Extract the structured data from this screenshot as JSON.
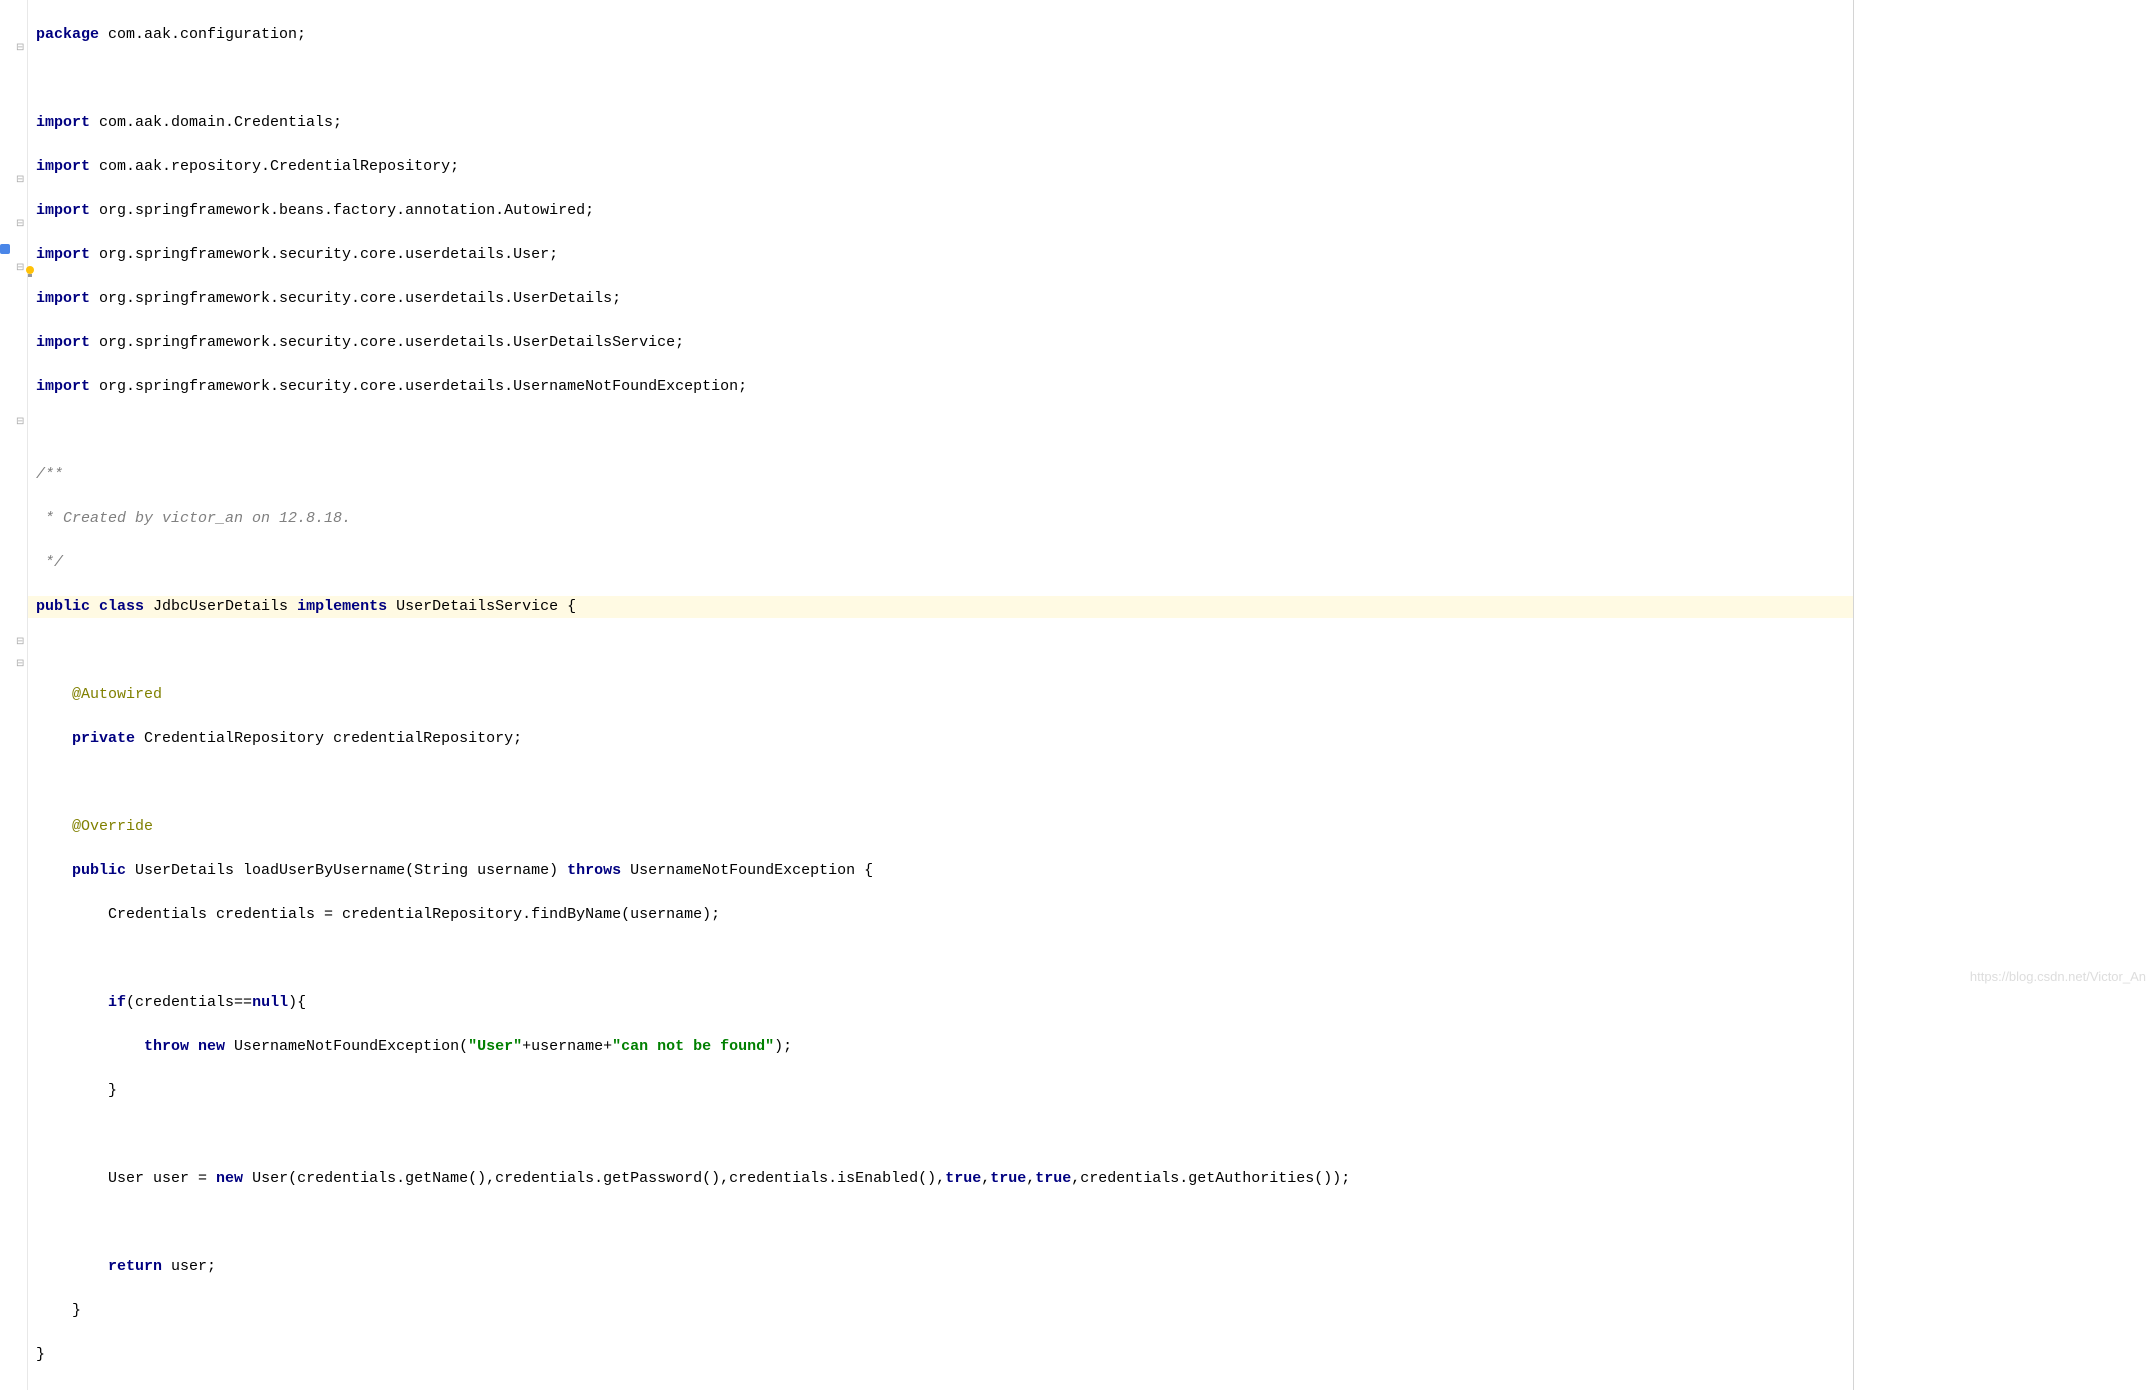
{
  "code": {
    "line1_kw": "package",
    "line1_rest": " com.aak.configuration;",
    "line3_kw": "import",
    "line3_rest": " com.aak.domain.Credentials;",
    "line4_kw": "import",
    "line4_rest": " com.aak.repository.CredentialRepository;",
    "line5_kw": "import",
    "line5_rest": " org.springframework.beans.factory.annotation.Autowired;",
    "line6_kw": "import",
    "line6_rest": " org.springframework.security.core.userdetails.User;",
    "line7_kw": "import",
    "line7_rest": " org.springframework.security.core.userdetails.UserDetails;",
    "line8_kw": "import",
    "line8_rest": " org.springframework.security.core.userdetails.UserDetailsService;",
    "line9_kw": "import",
    "line9_rest": " org.springframework.security.core.userdetails.UsernameNotFoundException;",
    "line11": "/**",
    "line12": " * Created by victor_an on 12.8.18.",
    "line13": " */",
    "line14_kw1": "public class",
    "line14_cls": " JdbcU",
    "line14_cls2": "serDetails ",
    "line14_kw2": "implements",
    "line14_rest": " UserDetailsService {",
    "line16_pad": "    ",
    "line16_anno": "@Autowired",
    "line17_pad": "    ",
    "line17_kw": "private",
    "line17_rest": " CredentialRepository credentialRepository;",
    "line19_pad": "    ",
    "line19_anno": "@Override",
    "line20_pad": "    ",
    "line20_kw1": "public",
    "line20_mid": " UserDetails loadUserByUsername(String username) ",
    "line20_kw2": "throws",
    "line20_rest": " UsernameNotFoundException {",
    "line21_pad": "        ",
    "line21_rest": "Credentials credentials = credentialRepository.findByName(username);",
    "line23_pad": "        ",
    "line23_kw": "if",
    "line23_mid": "(credentials==",
    "line23_kw2": "null",
    "line23_rest": "){",
    "line24_pad": "            ",
    "line24_kw1": "throw new",
    "line24_mid": " UsernameNotFoundException(",
    "line24_str1": "\"User\"",
    "line24_plus": "+username+",
    "line24_str2": "\"can not be found\"",
    "line24_rest": ");",
    "line25_pad": "        ",
    "line25_rest": "}",
    "line27_pad": "        ",
    "line27_a": "User user = ",
    "line27_kw": "new",
    "line27_b": " User(credentials.getName(),credentials.getPassword(),credentials.isEnabled(),",
    "line27_kw2": "true",
    "line27_c": ",",
    "line27_kw3": "true",
    "line27_d": ",",
    "line27_kw4": "true",
    "line27_e": ",credentials.getAuthorities());",
    "line29_pad": "        ",
    "line29_kw": "return",
    "line29_rest": " user;",
    "line30_pad": "    ",
    "line30_rest": "}",
    "line31_rest": "}"
  },
  "watermark": "https://blog.csdn.net/Victor_An"
}
